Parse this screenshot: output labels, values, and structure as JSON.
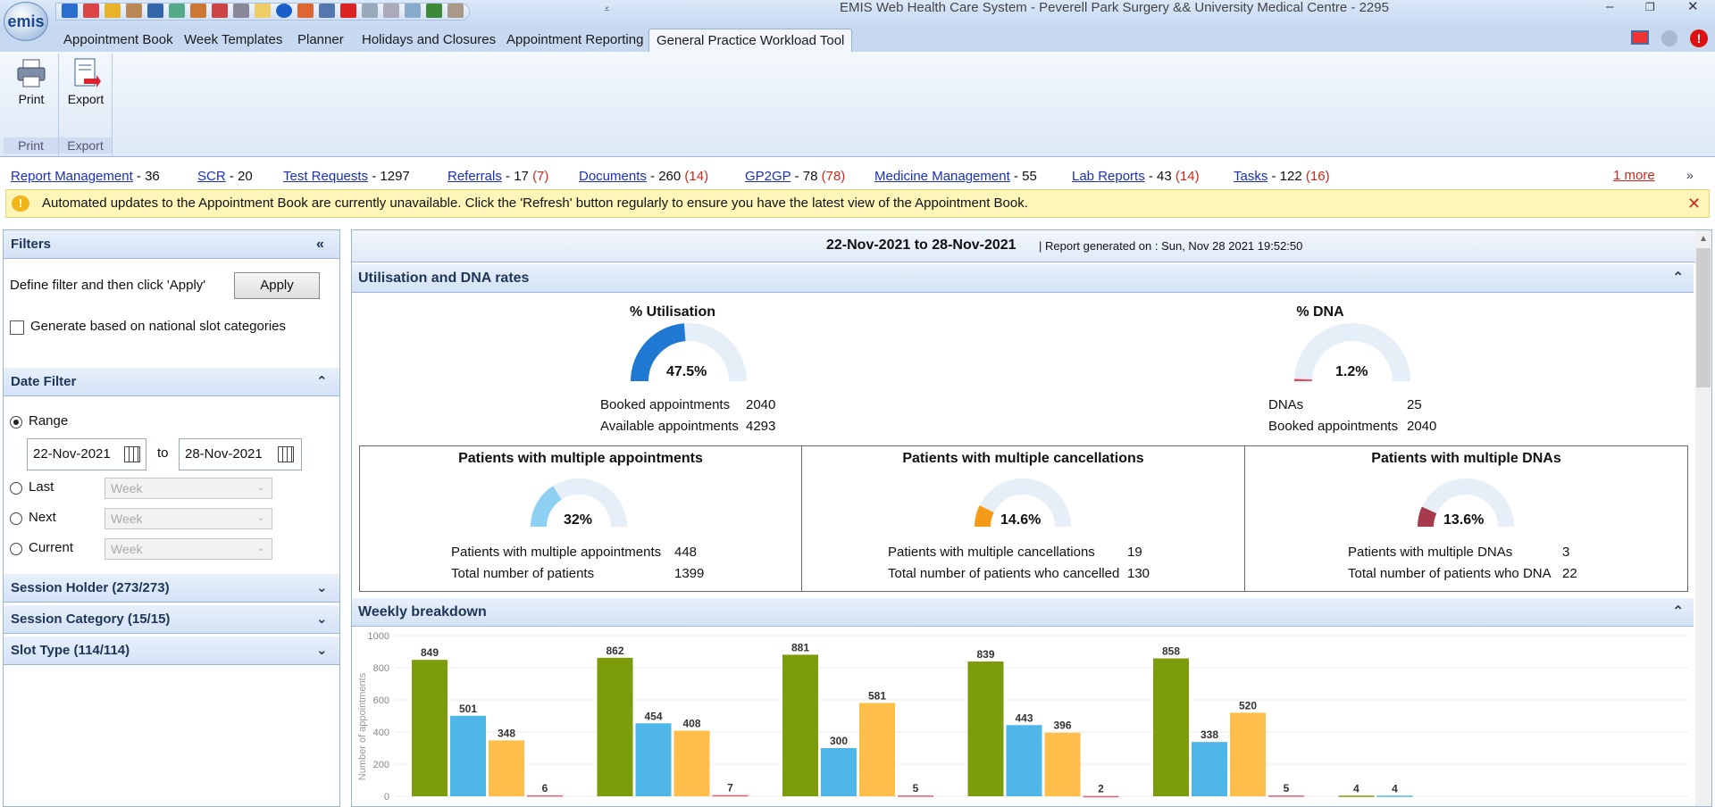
{
  "app": {
    "logo": "emis",
    "title": "EMIS Web Health Care System - Peverell Park Surgery && University Medical Centre - 2295",
    "window_controls": [
      "–",
      "❐",
      "✕"
    ]
  },
  "ribbon_tabs": [
    "Appointment Book",
    "Week Templates",
    "Planner",
    "Holidays and Closures",
    "Appointment Reporting",
    "General Practice Workload Tool"
  ],
  "ribbon_groups": [
    {
      "button": "Print",
      "group": "Print"
    },
    {
      "button": "Export",
      "group": "Export"
    }
  ],
  "links": [
    {
      "label": "Report Management",
      "count": "- 36",
      "extra": ""
    },
    {
      "label": "SCR",
      "count": "- 20",
      "extra": ""
    },
    {
      "label": "Test Requests",
      "count": "- 1297",
      "extra": ""
    },
    {
      "label": "Referrals",
      "count": "- 17",
      "extra": "(7)"
    },
    {
      "label": "Documents",
      "count": "- 260",
      "extra": "(14)"
    },
    {
      "label": "GP2GP",
      "count": "- 78",
      "extra": "(78)"
    },
    {
      "label": "Medicine Management",
      "count": "- 55",
      "extra": ""
    },
    {
      "label": "Lab Reports",
      "count": "- 43",
      "extra": "(14)"
    },
    {
      "label": "Tasks",
      "count": "- 122",
      "extra": "(16)"
    }
  ],
  "more_link": "1 more",
  "warning": "Automated updates to the Appointment Book are currently unavailable. Click the 'Refresh' button regularly to ensure you have the latest view of the Appointment Book.",
  "filters": {
    "header": "Filters",
    "define_text": "Define filter and then click 'Apply'",
    "apply": "Apply",
    "national_label": "Generate based on national slot categories",
    "date_filter_header": "Date Filter",
    "range_label": "Range",
    "from_date": "22-Nov-2021",
    "to_label": "to",
    "to_date": "28-Nov-2021",
    "last_label": "Last",
    "next_label": "Next",
    "current_label": "Current",
    "period_option": "Week",
    "session_holder": "Session Holder (273/273)",
    "session_category": "Session Category (15/15)",
    "slot_type": "Slot Type (114/114)"
  },
  "report": {
    "date_range": "22-Nov-2021 to 28-Nov-2021",
    "generated": "| Report generated on : Sun, Nov 28 2021 19:52:50",
    "util_header": "Utilisation and DNA rates",
    "util_title": "% Utilisation",
    "util_value": "47.5%",
    "util_fraction": 0.475,
    "booked_label": "Booked appointments",
    "booked_value": "2040",
    "available_label": "Available appointments",
    "available_value": "4293",
    "dna_title": "% DNA",
    "dna_value": "1.2%",
    "dna_fraction": 0.012,
    "dnas_label": "DNAs",
    "dnas_value": "25",
    "dna_booked_label": "Booked appointments",
    "dna_booked_value": "2040",
    "multi_appt_title": "Patients with multiple appointments",
    "multi_appt_pct": "32%",
    "multi_appt_fraction": 0.32,
    "multi_appt_label": "Patients with multiple appointments",
    "multi_appt_value": "448",
    "total_patients_label": "Total number of patients",
    "total_patients_value": "1399",
    "multi_cancel_title": "Patients with multiple cancellations",
    "multi_cancel_pct": "14.6%",
    "multi_cancel_fraction": 0.146,
    "multi_cancel_label": "Patients with multiple cancellations",
    "multi_cancel_value": "19",
    "total_cancel_label": "Total number of patients who cancelled",
    "total_cancel_value": "130",
    "multi_dna_title": "Patients with multiple DNAs",
    "multi_dna_pct": "13.6%",
    "multi_dna_fraction": 0.136,
    "multi_dna_label": "Patients with multiple DNAs",
    "multi_dna_value": "3",
    "total_dna_label": "Total number of patients who DNA",
    "total_dna_value": "22",
    "weekly_header": "Weekly breakdown"
  },
  "colors": {
    "accent_blue": "#1f78d1",
    "light_blue": "#4fb7e8",
    "green": "#7c9c0c",
    "orange": "#ffbe4a",
    "red": "#e35f6e",
    "dna_pink": "#e8465e",
    "cancel_orange": "#f59b1a",
    "multidna_maroon": "#a83a4e",
    "warn_red": "#d0261b"
  },
  "chart_data": {
    "type": "bar",
    "ylabel": "Number of appointments",
    "ylim": [
      0,
      1000
    ],
    "yticks": [
      0,
      200,
      400,
      600,
      800,
      1000
    ],
    "groups": [
      [
        849,
        501,
        348,
        6
      ],
      [
        862,
        454,
        408,
        7
      ],
      [
        881,
        300,
        581,
        5
      ],
      [
        839,
        443,
        396,
        2
      ],
      [
        858,
        338,
        520,
        5
      ],
      [
        4,
        4,
        null,
        null
      ]
    ],
    "series_colors": [
      "#7c9c0c",
      "#4fb7e8",
      "#ffbe4a",
      "#e35f6e"
    ]
  }
}
